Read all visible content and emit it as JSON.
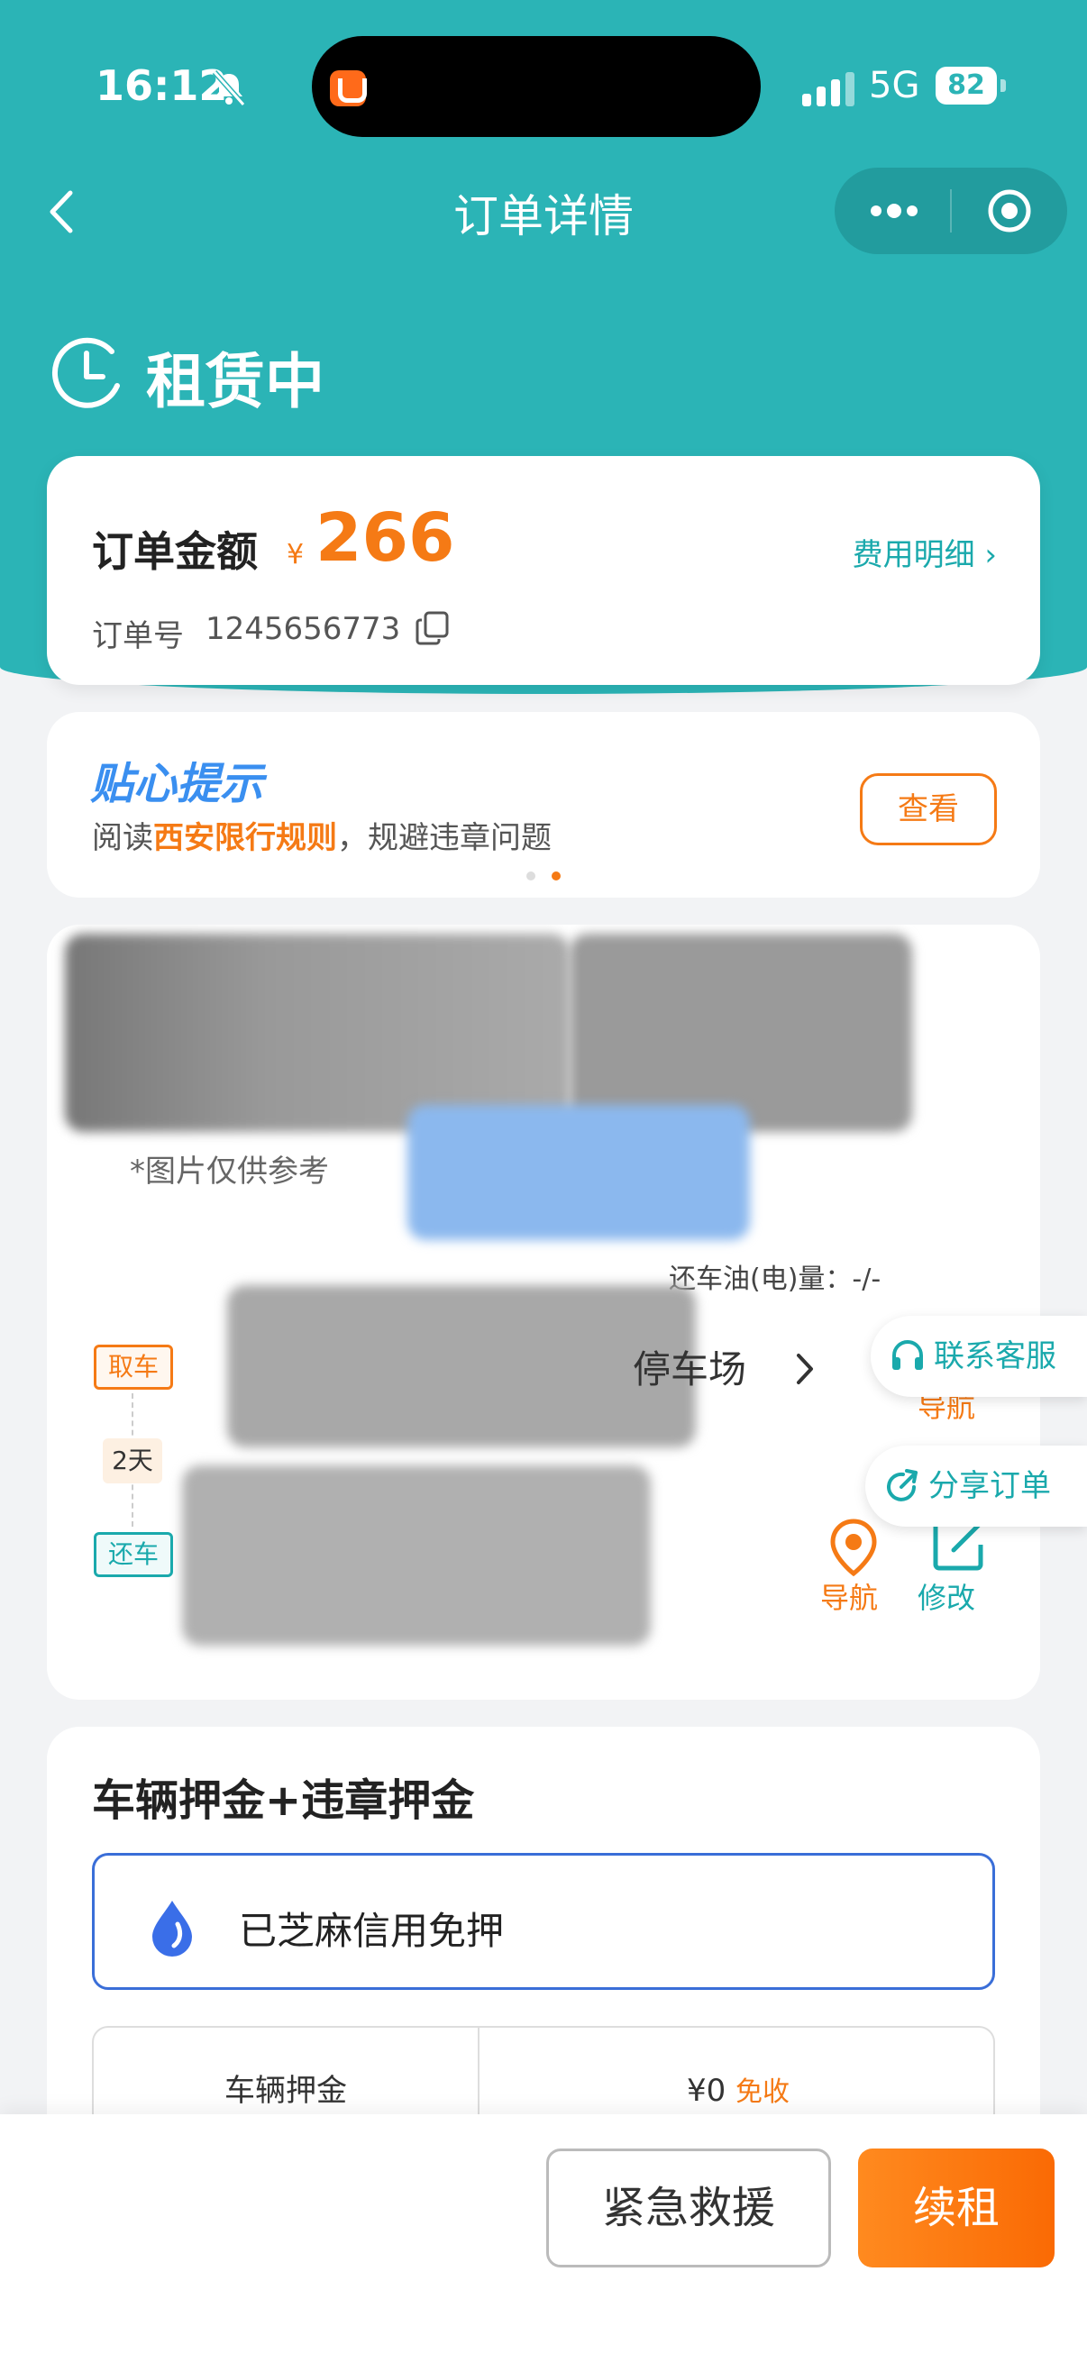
{
  "status_bar": {
    "time": "16:12",
    "network": "5G",
    "battery": "82"
  },
  "nav": {
    "title": "订单详情"
  },
  "order_status": {
    "title": "租赁中"
  },
  "amount_card": {
    "label": "订单金额",
    "currency": "¥",
    "amount": "266",
    "fee_detail": "费用明细 ›",
    "order_no_label": "订单号",
    "order_no": "1245656773"
  },
  "tip_card": {
    "title": "贴心提示",
    "text_prefix": "阅读",
    "text_highlight": "西安限行规则",
    "text_suffix": "，规避违章问题",
    "view_label": "查看"
  },
  "car_card": {
    "ref_note": "*图片仅供参考",
    "fuel_text": "还车油(电)量：-/-",
    "pickup_tag": "取车",
    "days_tag": "2天",
    "return_tag": "还车",
    "pickup_location": "停车场",
    "nav_label_top": "导航",
    "nav_label": "导航",
    "edit_label": "修改"
  },
  "floating": {
    "customer_service": "联系客服",
    "share_order": "分享订单"
  },
  "deposit": {
    "title": "车辆押金+违章押金",
    "credit_text": "已芝麻信用免押",
    "row_label": "车辆押金",
    "row_value": "¥0",
    "row_badge": "免收"
  },
  "actions": {
    "sos": "紧急救援",
    "renew": "续租"
  },
  "colors": {
    "teal": "#2bb4b6",
    "orange": "#f57a15",
    "blue": "#3a8ff0"
  }
}
